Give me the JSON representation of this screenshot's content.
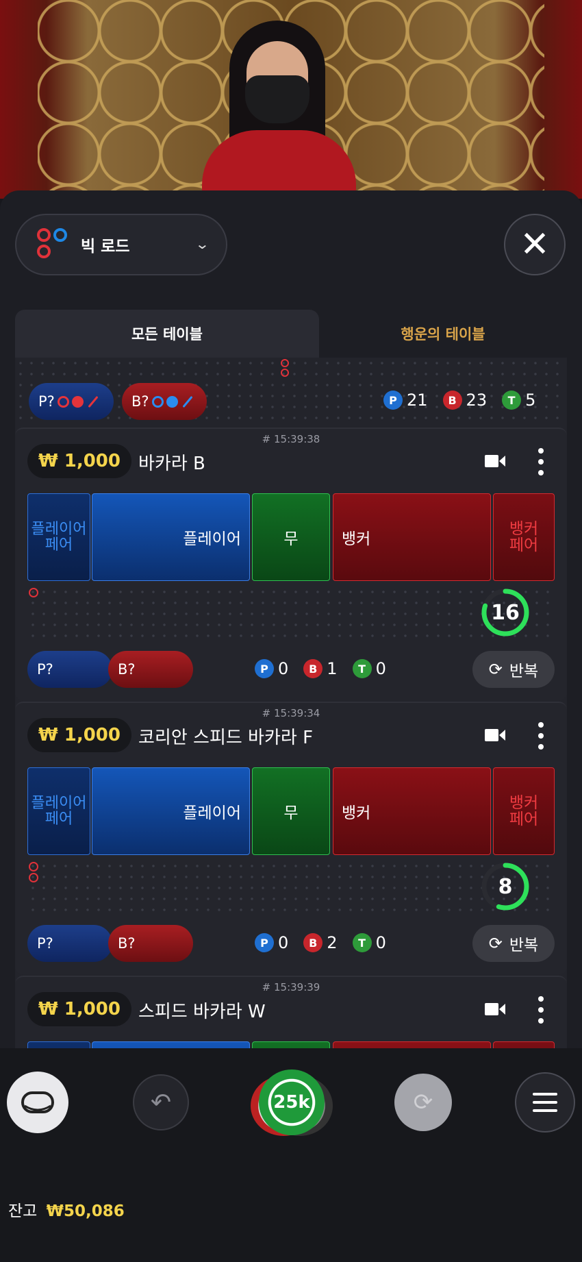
{
  "header": {
    "road_label": "빅 로드"
  },
  "tabs": [
    {
      "label": "모든 테이블"
    },
    {
      "label": "행운의 테이블"
    }
  ],
  "top_summary": {
    "pill_p": "P?",
    "pill_b": "B?",
    "player_count": "21",
    "banker_count": "23",
    "tie_count": "5"
  },
  "badges": {
    "p": "P",
    "b": "B",
    "t": "T"
  },
  "tables": [
    {
      "time": "# 15:39:38",
      "stake": "₩ 1,000",
      "name": "바카라 B",
      "player_pair": "플레이어\n페어",
      "player": "플레이어",
      "tie": "무",
      "banker": "뱅커",
      "banker_pair": "뱅커\n페어",
      "timer": "16",
      "timer_fraction": 0.8,
      "pill_p": "P?",
      "pill_b": "B?",
      "p_count": "0",
      "b_count": "1",
      "t_count": "0",
      "repeat": "반복"
    },
    {
      "time": "# 15:39:34",
      "stake": "₩ 1,000",
      "name": "코리안 스피드 바카라 F",
      "player_pair": "플레이어\n페어",
      "player": "플레이어",
      "tie": "무",
      "banker": "뱅커",
      "banker_pair": "뱅커\n페어",
      "timer": "8",
      "timer_fraction": 0.55,
      "pill_p": "P?",
      "pill_b": "B?",
      "p_count": "0",
      "b_count": "2",
      "t_count": "0",
      "repeat": "반복"
    },
    {
      "time": "# 15:39:39",
      "stake": "₩ 1,000",
      "name": "스피드 바카라 W"
    }
  ],
  "bottom": {
    "chip_label": "25k",
    "balance_label": "잔고",
    "balance_value": "₩50,086"
  },
  "colors": {
    "accent_gold": "#f4d44c",
    "player_blue": "#1456b8",
    "banker_red": "#8a1016",
    "tie_green": "#127024",
    "timer_green": "#2ee05a"
  }
}
